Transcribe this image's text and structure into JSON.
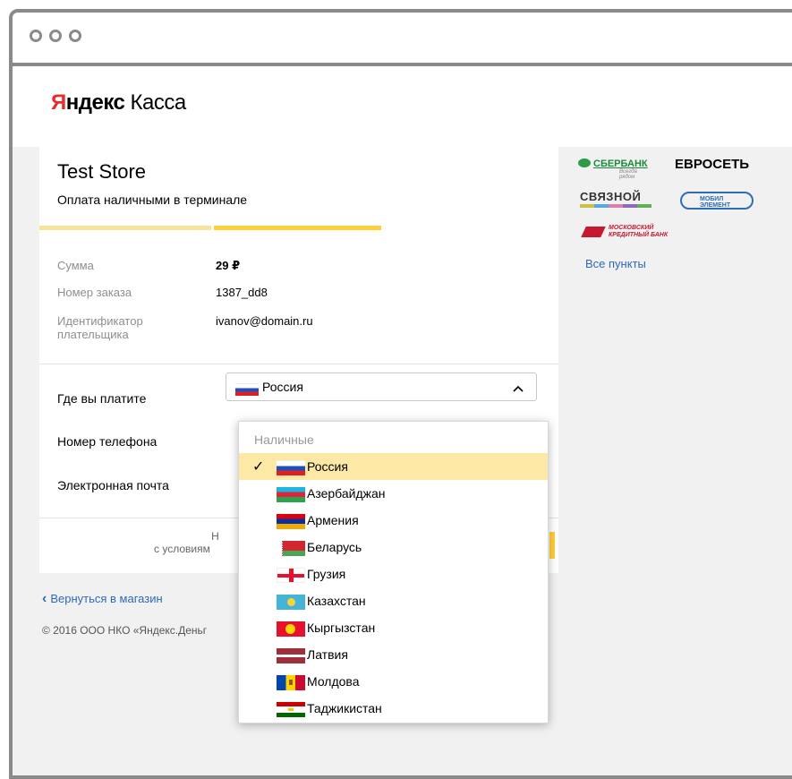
{
  "brand": {
    "logo_red": "Я",
    "logo_bold": "ндекс",
    "logo_rest": " Касса"
  },
  "store": {
    "title": "Test Store",
    "subtitle": "Оплата наличными в терминале"
  },
  "details": [
    {
      "label": "Сумма",
      "value": "29 ₽"
    },
    {
      "label": "Номер заказа",
      "value": "1387_dd8"
    },
    {
      "label": "Идентификатор плательщика",
      "value": "ivanov@domain.ru"
    }
  ],
  "form": {
    "where_label": "Где вы платите",
    "phone_label": "Номер телефона",
    "email_label": "Электронная почта",
    "selected_country": "Россия",
    "terms_fragment_1": "Н",
    "terms_fragment_2": "с условиям"
  },
  "dropdown": {
    "group_label": "Наличные",
    "items": [
      {
        "name": "Россия",
        "flag": "ru-flag-icon",
        "selected": true
      },
      {
        "name": "Азербайджан",
        "flag": "az-flag-icon"
      },
      {
        "name": "Армения",
        "flag": "am-flag-icon"
      },
      {
        "name": "Беларусь",
        "flag": "by-flag-icon"
      },
      {
        "name": "Грузия",
        "flag": "ge-flag-icon"
      },
      {
        "name": "Казахстан",
        "flag": "kz-flag-icon"
      },
      {
        "name": "Кыргызстан",
        "flag": "kg-flag-icon"
      },
      {
        "name": "Латвия",
        "flag": "lv-flag-icon"
      },
      {
        "name": "Молдова",
        "flag": "md-flag-icon"
      },
      {
        "name": "Таджикистан",
        "flag": "tj-flag-icon"
      }
    ]
  },
  "partners": {
    "sber": "СБЕРБАНК",
    "sber_sub": "Всегда рядом",
    "evroset": "ЕВРОСЕТЬ",
    "svyaznoy": "СВЯЗНОЙ",
    "mobil_1": "МОБИЛ",
    "mobil_2": "ЭЛЕМЕНТ",
    "mkb_1": "МОСКОВСКИЙ",
    "mkb_2": "КРЕДИТНЫЙ БАНК",
    "all_points": "Все пункты"
  },
  "footer": {
    "back_link": "Вернуться в магазин",
    "back_arrow": "‹",
    "copyright": "© 2016  ООО НКО «Яндекс.Деньг"
  },
  "icons": {
    "check": "✓",
    "chevron_up": "⌃"
  },
  "colors": {
    "accent_yellow": "#ffcf3a",
    "selected_row": "#fde8a6",
    "link_blue": "#2d6ab5",
    "brand_red": "#e62e2e"
  }
}
